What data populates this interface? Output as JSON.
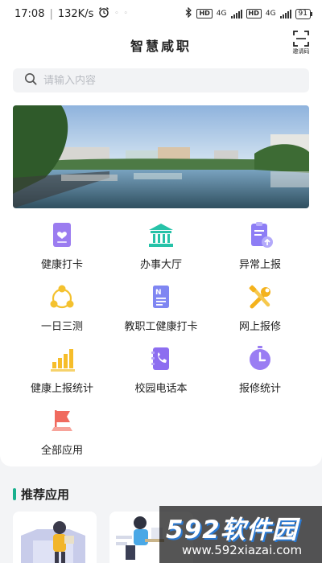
{
  "status_bar": {
    "time": "17:08",
    "speed": "132K/s",
    "hd1": "HD",
    "net1": "4G",
    "hd2": "HD",
    "net2": "4G",
    "battery": "91"
  },
  "header": {
    "title": "智慧咸职",
    "invite_label": "邀请码",
    "invite_icon": "scan-frame-icon"
  },
  "search": {
    "placeholder": "请输入内容",
    "icon": "search-icon"
  },
  "banner": {
    "image": "campus-lake-photo"
  },
  "apps": [
    {
      "label": "健康打卡",
      "icon": "health-card-icon",
      "color": "#9b7cf0"
    },
    {
      "label": "办事大厅",
      "icon": "bank-building-icon",
      "color": "#26c2a8"
    },
    {
      "label": "异常上报",
      "icon": "clipboard-upload-icon",
      "color": "#8d7df5"
    },
    {
      "label": "一日三测",
      "icon": "cycle-nodes-icon",
      "color": "#f4c12e"
    },
    {
      "label": "教职工健康打卡",
      "icon": "document-n-icon",
      "color": "#7f86f2"
    },
    {
      "label": "网上报修",
      "icon": "tools-icon",
      "color": "#f4b21c"
    },
    {
      "label": "健康上报统计",
      "icon": "bar-stats-icon",
      "color": "#f6bd2a"
    },
    {
      "label": "校园电话本",
      "icon": "phone-book-icon",
      "color": "#8d6ef0"
    },
    {
      "label": "报修统计",
      "icon": "clock-icon",
      "color": "#9a7df3"
    },
    {
      "label": "全部应用",
      "icon": "flag-icon",
      "color": "#f06a5e"
    }
  ],
  "recommended": {
    "title": "推荐应用",
    "accent": "#19b08e"
  },
  "watermark": {
    "brand": "592软件园",
    "url": "www.592xiazai.com"
  }
}
